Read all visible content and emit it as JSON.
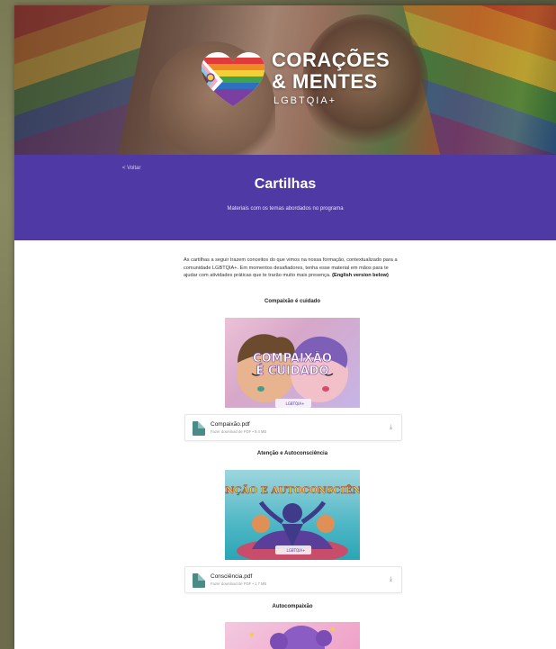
{
  "brand": {
    "line1": "CORAÇÕES",
    "line2": "& MENTES",
    "line3": "LGBTQIA+"
  },
  "nav": {
    "back_label": "< Voltar"
  },
  "header": {
    "title": "Cartilhas",
    "subtitle": "Materiais com os temas abordados no programa"
  },
  "intro": {
    "text": "As cartilhas a seguir trazem conceitos do que vimos na nossa formação, contextualizado para a comunidade LGBTQIA+. Em momentos desafiadores, tenha esse material em mãos para te ajudar com atividades práticas que te trarão muito mais presença. ",
    "english_note": "(English version below)"
  },
  "sections": [
    {
      "title": "Compaixão é cuidado",
      "card_text_1": "COMPAIXÃO",
      "card_text_2": "É CUIDADO",
      "card_logo_small": "LGBTQIA+",
      "file_name": "Compaixão.pdf",
      "file_meta": "Fazer download de PDF • 9,4 MB"
    },
    {
      "title": "Atenção e Autoconsciência",
      "card_text_1": "ATENÇÃO E AUTOCONSCIÊNCIA",
      "card_logo_small": "LGBTQIA+",
      "file_name": "Consciência.pdf",
      "file_meta": "Fazer download de PDF • 1,7 MB"
    },
    {
      "title": "Autocompaixão"
    }
  ],
  "colors": {
    "band": "#4f3aa5",
    "file_icon": "#4a8a87"
  }
}
